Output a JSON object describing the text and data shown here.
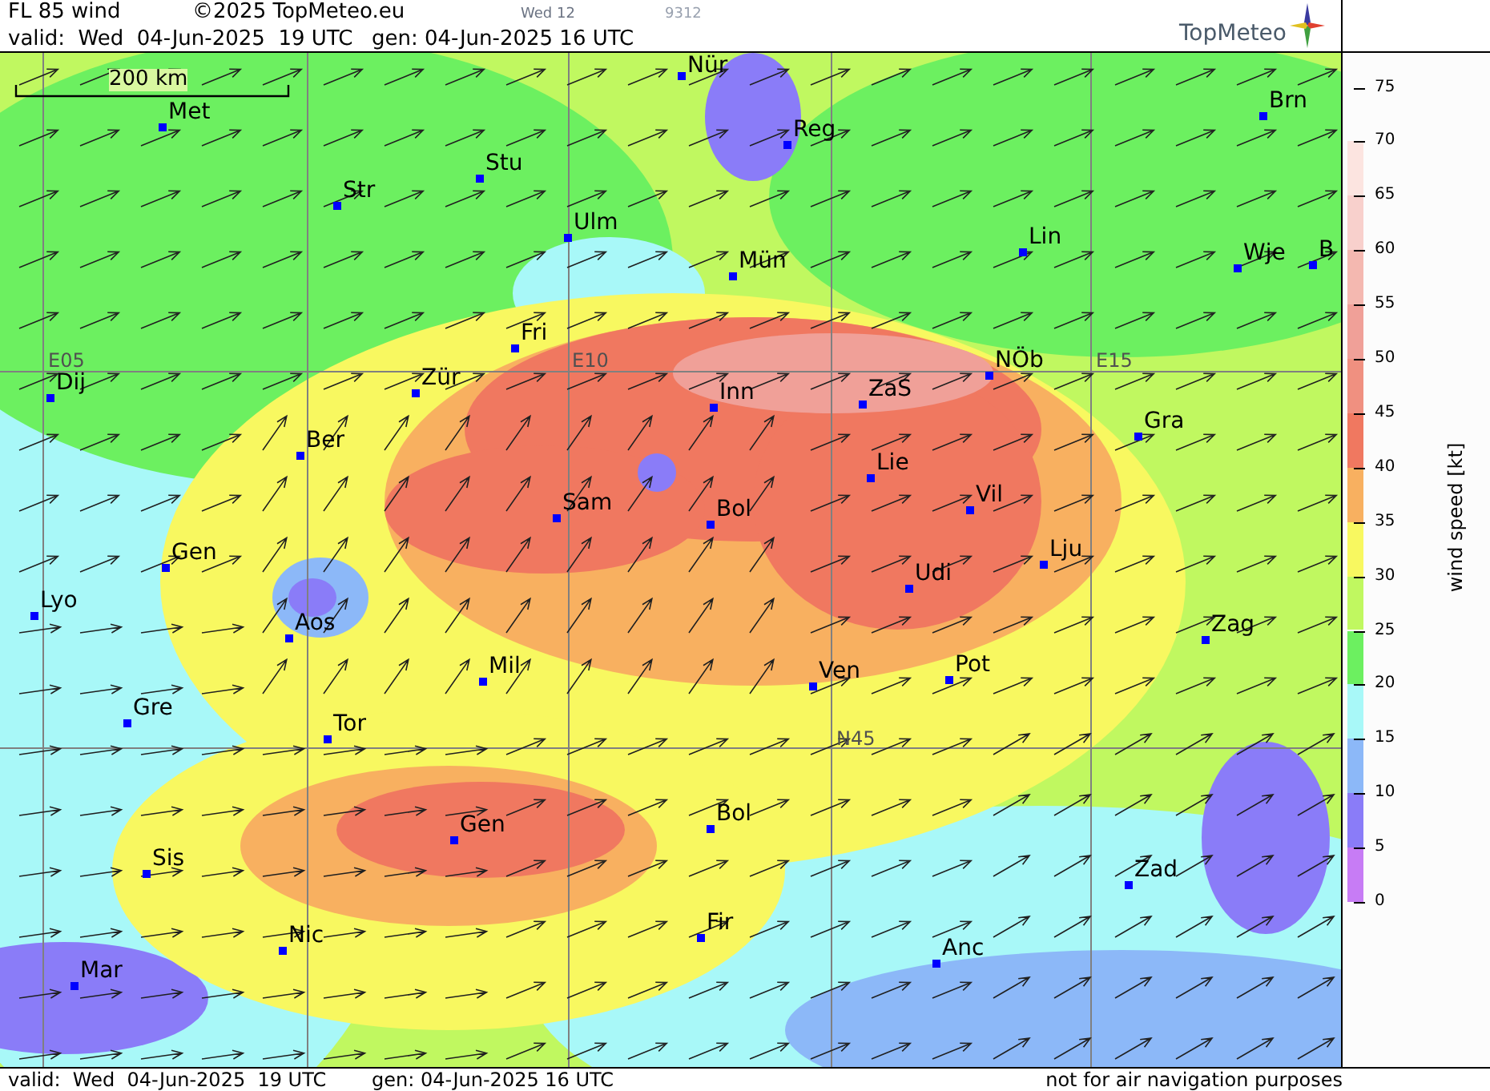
{
  "header": {
    "title": "FL 85 wind",
    "copyright": "©2025 TopMeteo.eu",
    "frame_label": "Wed 12",
    "code": "9312",
    "valid": "valid:  Wed  04-Jun-2025  19 UTC",
    "generated": "gen: 04-Jun-2025 16 UTC",
    "logo": "TopMeteo"
  },
  "map": {
    "scale": "200 km",
    "grid_labels": [
      "E05",
      "E10",
      "E15",
      "N45"
    ],
    "cities": [
      {
        "name": "Nür"
      },
      {
        "name": "Reg"
      },
      {
        "name": "Met"
      },
      {
        "name": "Stu"
      },
      {
        "name": "Str"
      },
      {
        "name": "Ulm"
      },
      {
        "name": "Lin"
      },
      {
        "name": "Brn"
      },
      {
        "name": "Wje"
      },
      {
        "name": "B"
      },
      {
        "name": "Mün"
      },
      {
        "name": "Fri"
      },
      {
        "name": "Dij"
      },
      {
        "name": "Zür"
      },
      {
        "name": "Inn"
      },
      {
        "name": "ZaS"
      },
      {
        "name": "NÖb"
      },
      {
        "name": "Gra"
      },
      {
        "name": "Ber"
      },
      {
        "name": "Lie"
      },
      {
        "name": "Vil"
      },
      {
        "name": "Sam"
      },
      {
        "name": "Bol"
      },
      {
        "name": "Gen"
      },
      {
        "name": "Lju"
      },
      {
        "name": "Udi"
      },
      {
        "name": "Lyo"
      },
      {
        "name": "Aos"
      },
      {
        "name": "Zag"
      },
      {
        "name": "Mil"
      },
      {
        "name": "Ven"
      },
      {
        "name": "Pot"
      },
      {
        "name": "Gre"
      },
      {
        "name": "Tor"
      },
      {
        "name": "Gen"
      },
      {
        "name": "Bol"
      },
      {
        "name": "Zad"
      },
      {
        "name": "Sis"
      },
      {
        "name": "Nic"
      },
      {
        "name": "Fir"
      },
      {
        "name": "Anc"
      },
      {
        "name": "Mar"
      }
    ]
  },
  "legend": {
    "title": "wind speed [kt]",
    "ticks": [
      "75",
      "70",
      "65",
      "60",
      "55",
      "50",
      "45",
      "40",
      "35",
      "30",
      "25",
      "20",
      "15",
      "10",
      "5",
      "0"
    ],
    "bands": [
      {
        "color": "#fce4e0"
      },
      {
        "color": "#f8d0cc"
      },
      {
        "color": "#f4b8b0"
      },
      {
        "color": "#f0a098"
      },
      {
        "color": "#f09080"
      },
      {
        "color": "#f07860"
      },
      {
        "color": "#f8b060"
      },
      {
        "color": "#f8f860"
      },
      {
        "color": "#c0f860"
      },
      {
        "color": "#6cf060"
      },
      {
        "color": "#a8f8f8"
      },
      {
        "color": "#8cb8f8"
      },
      {
        "color": "#8a7cf8"
      },
      {
        "color": "#c77cf5"
      }
    ]
  },
  "footer": {
    "valid": "valid:  Wed  04-Jun-2025  19 UTC",
    "generated": "gen: 04-Jun-2025 16 UTC",
    "note": "not for air navigation purposes"
  }
}
